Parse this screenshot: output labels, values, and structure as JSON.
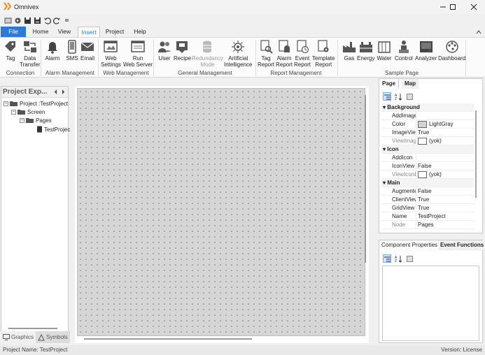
{
  "app": {
    "title": "Omnivex"
  },
  "window_controls": [
    "minimize-icon",
    "maximize-icon",
    "close-icon"
  ],
  "quick_access": [
    "new-icon",
    "open-icon",
    "save-icon",
    "save-all-icon",
    "undo-icon",
    "redo-icon",
    "customize-icon"
  ],
  "tabs": [
    "File",
    "Home",
    "View",
    "Insert",
    "Project",
    "Help"
  ],
  "active_tab": "Insert",
  "ribbon": {
    "buttons": {
      "tag": "Tag",
      "data_transfer": "Data\nTransfer",
      "alarm": "Alarm",
      "sms": "SMS",
      "email": "Email",
      "web_settings": "Web\nSettings",
      "run_web_server": "Run\nWeb Server",
      "user": "User",
      "recipe": "Recipe",
      "redundancy_mode": "Redundancy\nMode",
      "artificial_intelligence": "Artificial\nIntelligence",
      "tag_report": "Tag\nReport",
      "alarm_report": "Alarm\nReport",
      "event_report": "Event\nReport",
      "template_report": "Template\nReport",
      "gas": "Gas",
      "energy": "Energy",
      "water": "Water",
      "control": "Control",
      "analyzer": "Analyzer",
      "dashboard": "Dashboard"
    },
    "groups": {
      "connection": "Connection",
      "alarm_management": "Alarm Management",
      "web_management": "Web Management",
      "general_management": "General Management",
      "report_management": "Report Management",
      "sample_page": "Sample Page"
    }
  },
  "explorer": {
    "title": "Project Exp...",
    "tree": {
      "project": "Project :TestProject",
      "screen": "Screen",
      "pages": "Pages",
      "page": "TestProjec"
    },
    "bottom_tabs": {
      "graphics": "Graphics",
      "symbols": "Symbols"
    }
  },
  "properties": {
    "tabs": {
      "page": "Page",
      "map": "Map"
    },
    "rows": {
      "background": "Background",
      "addimage": "AddImage",
      "color_k": "Color",
      "color_v": "LightGray",
      "imageview_k": "ImageView",
      "imageview_v": "True",
      "viewimagede_k": "ViewImageDe",
      "viewimagede_v": "(yok)",
      "icon": "Icon",
      "addicon": "AddIcon",
      "iconview_k": "IconView",
      "iconview_v": "False",
      "viewicondeta_k": "ViewIconDeta",
      "viewicondeta_v": "(yok)",
      "main": "Main",
      "augmented_k": "AugmentedRe",
      "augmented_v": "False",
      "clientview_k": "ClientView",
      "clientview_v": "True",
      "gridview_k": "GridView",
      "gridview_v": "True",
      "name_k": "Name",
      "name_v": "TestProject",
      "node_k": "Node",
      "node_v": "Pages"
    },
    "colors": {
      "lightgray": "#d3d3d3"
    }
  },
  "component": {
    "tabs": {
      "props": "Component Properties",
      "events": "Event Functions"
    }
  },
  "status": {
    "left": "Project Name: TestProject",
    "right": "Version: License"
  }
}
